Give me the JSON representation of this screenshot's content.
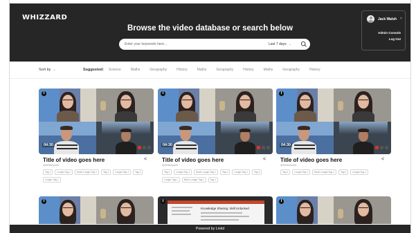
{
  "header": {
    "logo": "WHIZZARD",
    "title": "Browse the video database or search below"
  },
  "search": {
    "placeholder": "Enter your keywords here...",
    "date_filter": "Last 7 days"
  },
  "user": {
    "name": "Jack Walsh",
    "admin_link": "Admin Console",
    "logout_link": "Log Out"
  },
  "filter_bar": {
    "sort_label": "Sort by",
    "suggested_label": "Suggested:",
    "tags": [
      "Science",
      "Maths",
      "Geography",
      "History",
      "Maths",
      "Geography",
      "History",
      "Maths",
      "Geography",
      "History"
    ]
  },
  "cards": [
    {
      "title": "Title of video goes here",
      "author": "@Whitleywhit",
      "duration": "04:30",
      "tags": [
        "Tag 1",
        "Longer Tag 1",
        "Much Longer Tag 1",
        "Tag 1",
        "Longer Tag 1",
        "Tag 1",
        "Longer Tag 1"
      ]
    },
    {
      "title": "Title of video goes here",
      "author": "@Whitleywhit",
      "duration": "04:30",
      "tags": [
        "Tag 1",
        "Longer Tag 1",
        "Much Longer Tag 1",
        "Tag 1",
        "Longer Tag 1",
        "Tag 1",
        "Longer Tag 1",
        "Much Longer Tag 1",
        "Tag 1"
      ]
    },
    {
      "title": "Title of video goes here",
      "author": "@Whitleywhit",
      "duration": "04:30",
      "tags": [
        "Tag 1",
        "Longer Tag 1",
        "Much Longer Tag 1",
        "Tag 1",
        "Longer Tag 1"
      ]
    }
  ],
  "slide_preview": {
    "heading": "Knowledge Sharing: Skill Unlocked"
  },
  "footer": {
    "text": "Powered by Linkd"
  },
  "colors": {
    "header_bg": "#262626",
    "accent": "#4a90d9"
  }
}
